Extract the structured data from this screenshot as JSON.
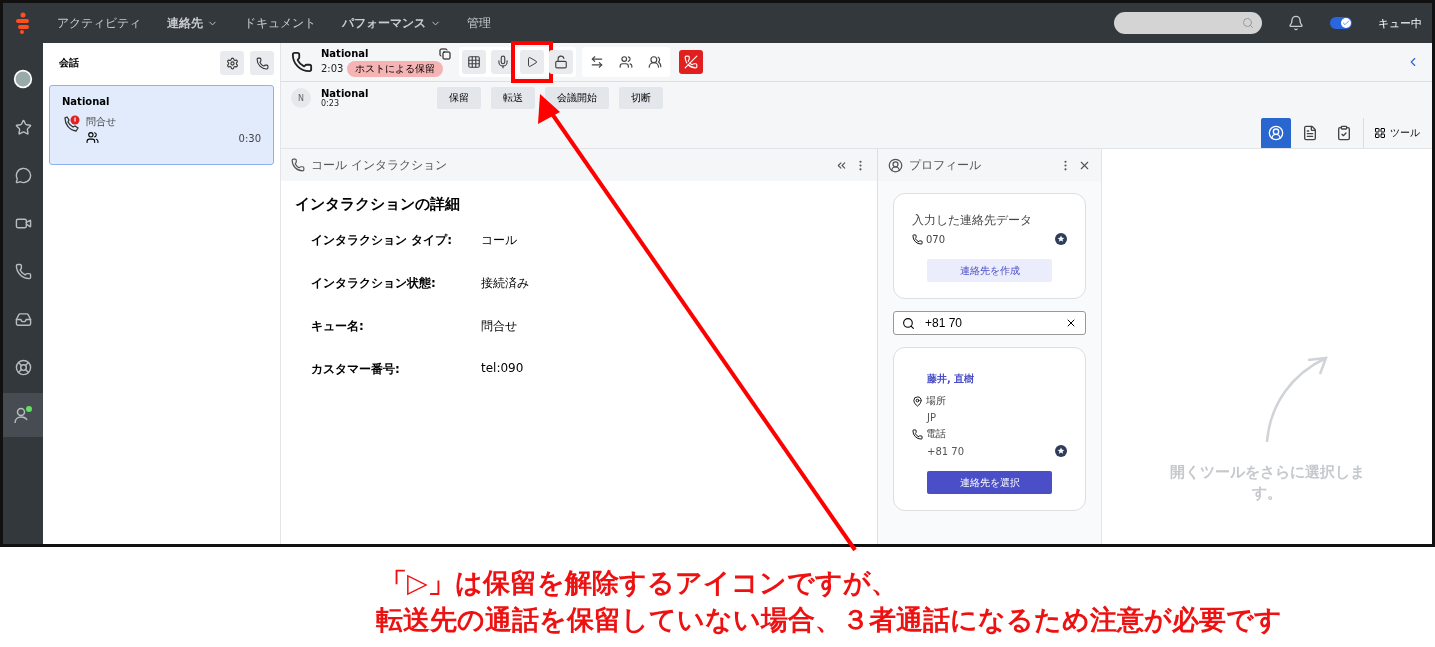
{
  "top_nav": {
    "items": [
      {
        "label": "アクティビティ",
        "dropdown": false
      },
      {
        "label": "連絡先",
        "dropdown": true
      },
      {
        "label": "ドキュメント",
        "dropdown": false
      },
      {
        "label": "パフォーマンス",
        "dropdown": true
      },
      {
        "label": "管理",
        "dropdown": false
      }
    ],
    "status_label": "キュー中",
    "queue_on": true
  },
  "left_rail": {
    "items": [
      {
        "kind": "avatar",
        "selected": false
      },
      {
        "kind": "star",
        "selected": false
      },
      {
        "kind": "chat",
        "selected": false
      },
      {
        "kind": "video",
        "selected": false
      },
      {
        "kind": "phone",
        "selected": false
      },
      {
        "kind": "inbox",
        "selected": false
      },
      {
        "kind": "help",
        "selected": false
      },
      {
        "kind": "agent",
        "selected": true
      }
    ]
  },
  "conversations": {
    "title": "会話",
    "items": [
      {
        "name": "National",
        "queue": "問合せ",
        "time": "0:30",
        "selected": true
      }
    ]
  },
  "call": {
    "name": "National",
    "time": "2:03",
    "status": "ホストによる保留",
    "controls": [
      {
        "kind": "keypad"
      },
      {
        "kind": "mic"
      },
      {
        "kind": "resume",
        "highlighted": true
      },
      {
        "kind": "unlock"
      },
      {
        "kind": "transfer"
      },
      {
        "kind": "consult"
      },
      {
        "kind": "conference"
      },
      {
        "kind": "hangup"
      }
    ],
    "participant": {
      "initial": "N",
      "name": "National",
      "time": "0:23",
      "actions": [
        "保留",
        "転送",
        "会議開始",
        "切断"
      ]
    }
  },
  "tools": {
    "items": [
      {
        "kind": "profile",
        "selected": true
      },
      {
        "kind": "notes",
        "selected": false
      },
      {
        "kind": "tasks",
        "selected": false
      }
    ],
    "label": "ツール"
  },
  "interaction_panel": {
    "title": "コール インタラクション",
    "heading": "インタラクションの詳細",
    "fields": [
      {
        "label": "インタラクション タイプ:",
        "value": "コール"
      },
      {
        "label": "インタラクション状態:",
        "value": "接続済み"
      },
      {
        "label": "キュー名:",
        "value": "問合せ"
      },
      {
        "label": "カスタマー番号:",
        "value": "tel:090"
      }
    ]
  },
  "profile_panel": {
    "title": "プロフィール",
    "entered": {
      "title": "入力した連絡先データ",
      "phone": "070",
      "button": "連絡先を作成"
    },
    "search": {
      "value": "+81 70"
    },
    "result": {
      "name": "藤井, 直樹",
      "location_label": "場所",
      "location": "JP",
      "phone_label": "電話",
      "phone": "+81 70",
      "button": "連絡先を選択"
    }
  },
  "tool_hint": "開くツールをさらに選択します。",
  "annotation": {
    "lines": [
      "「▷」は保留を解除するアイコンですが、",
      "転送先の通話を保留していない場合、３者通話になるため注意が必要です"
    ]
  }
}
